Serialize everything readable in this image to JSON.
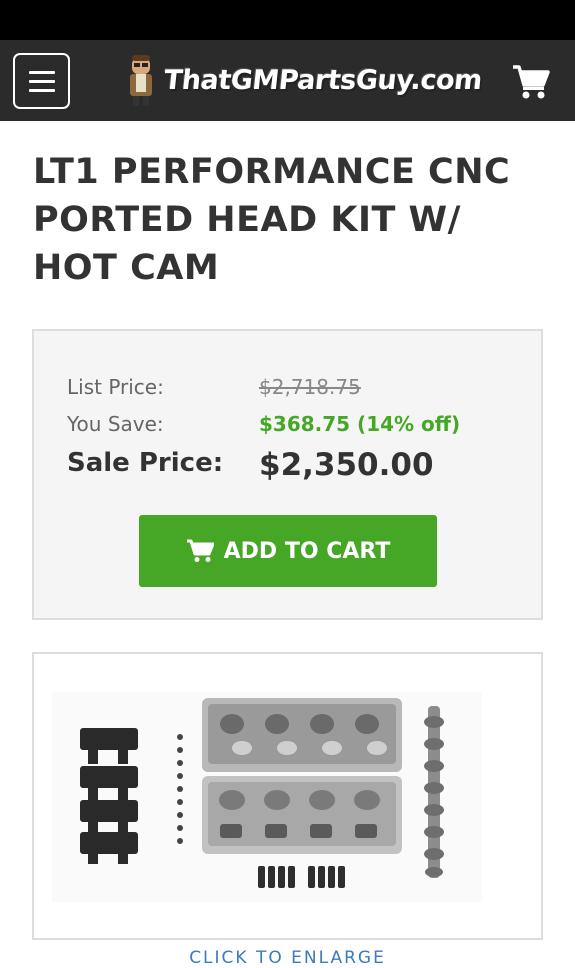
{
  "header": {
    "menu_icon": "hamburger-menu-icon",
    "logo_text": "ThatGMPartsGuy.com",
    "cart_icon": "shopping-cart-icon"
  },
  "product": {
    "title": "LT1 PERFORMANCE CNC PORTED HEAD KIT W/ HOT CAM"
  },
  "pricing": {
    "list_label": "List Price:",
    "list_value": "$2,718.75",
    "save_label": "You Save:",
    "save_value": "$368.75 (14% off)",
    "sale_label": "Sale Price:",
    "sale_value": "$2,350.00",
    "add_to_cart_label": "ADD TO CART"
  },
  "image": {
    "enlarge_label": "CLICK TO ENLARGE"
  },
  "colors": {
    "header_bg": "#2b2b2b",
    "accent_green": "#46a727",
    "savings_green": "#44a825",
    "text_dark": "#333333"
  }
}
